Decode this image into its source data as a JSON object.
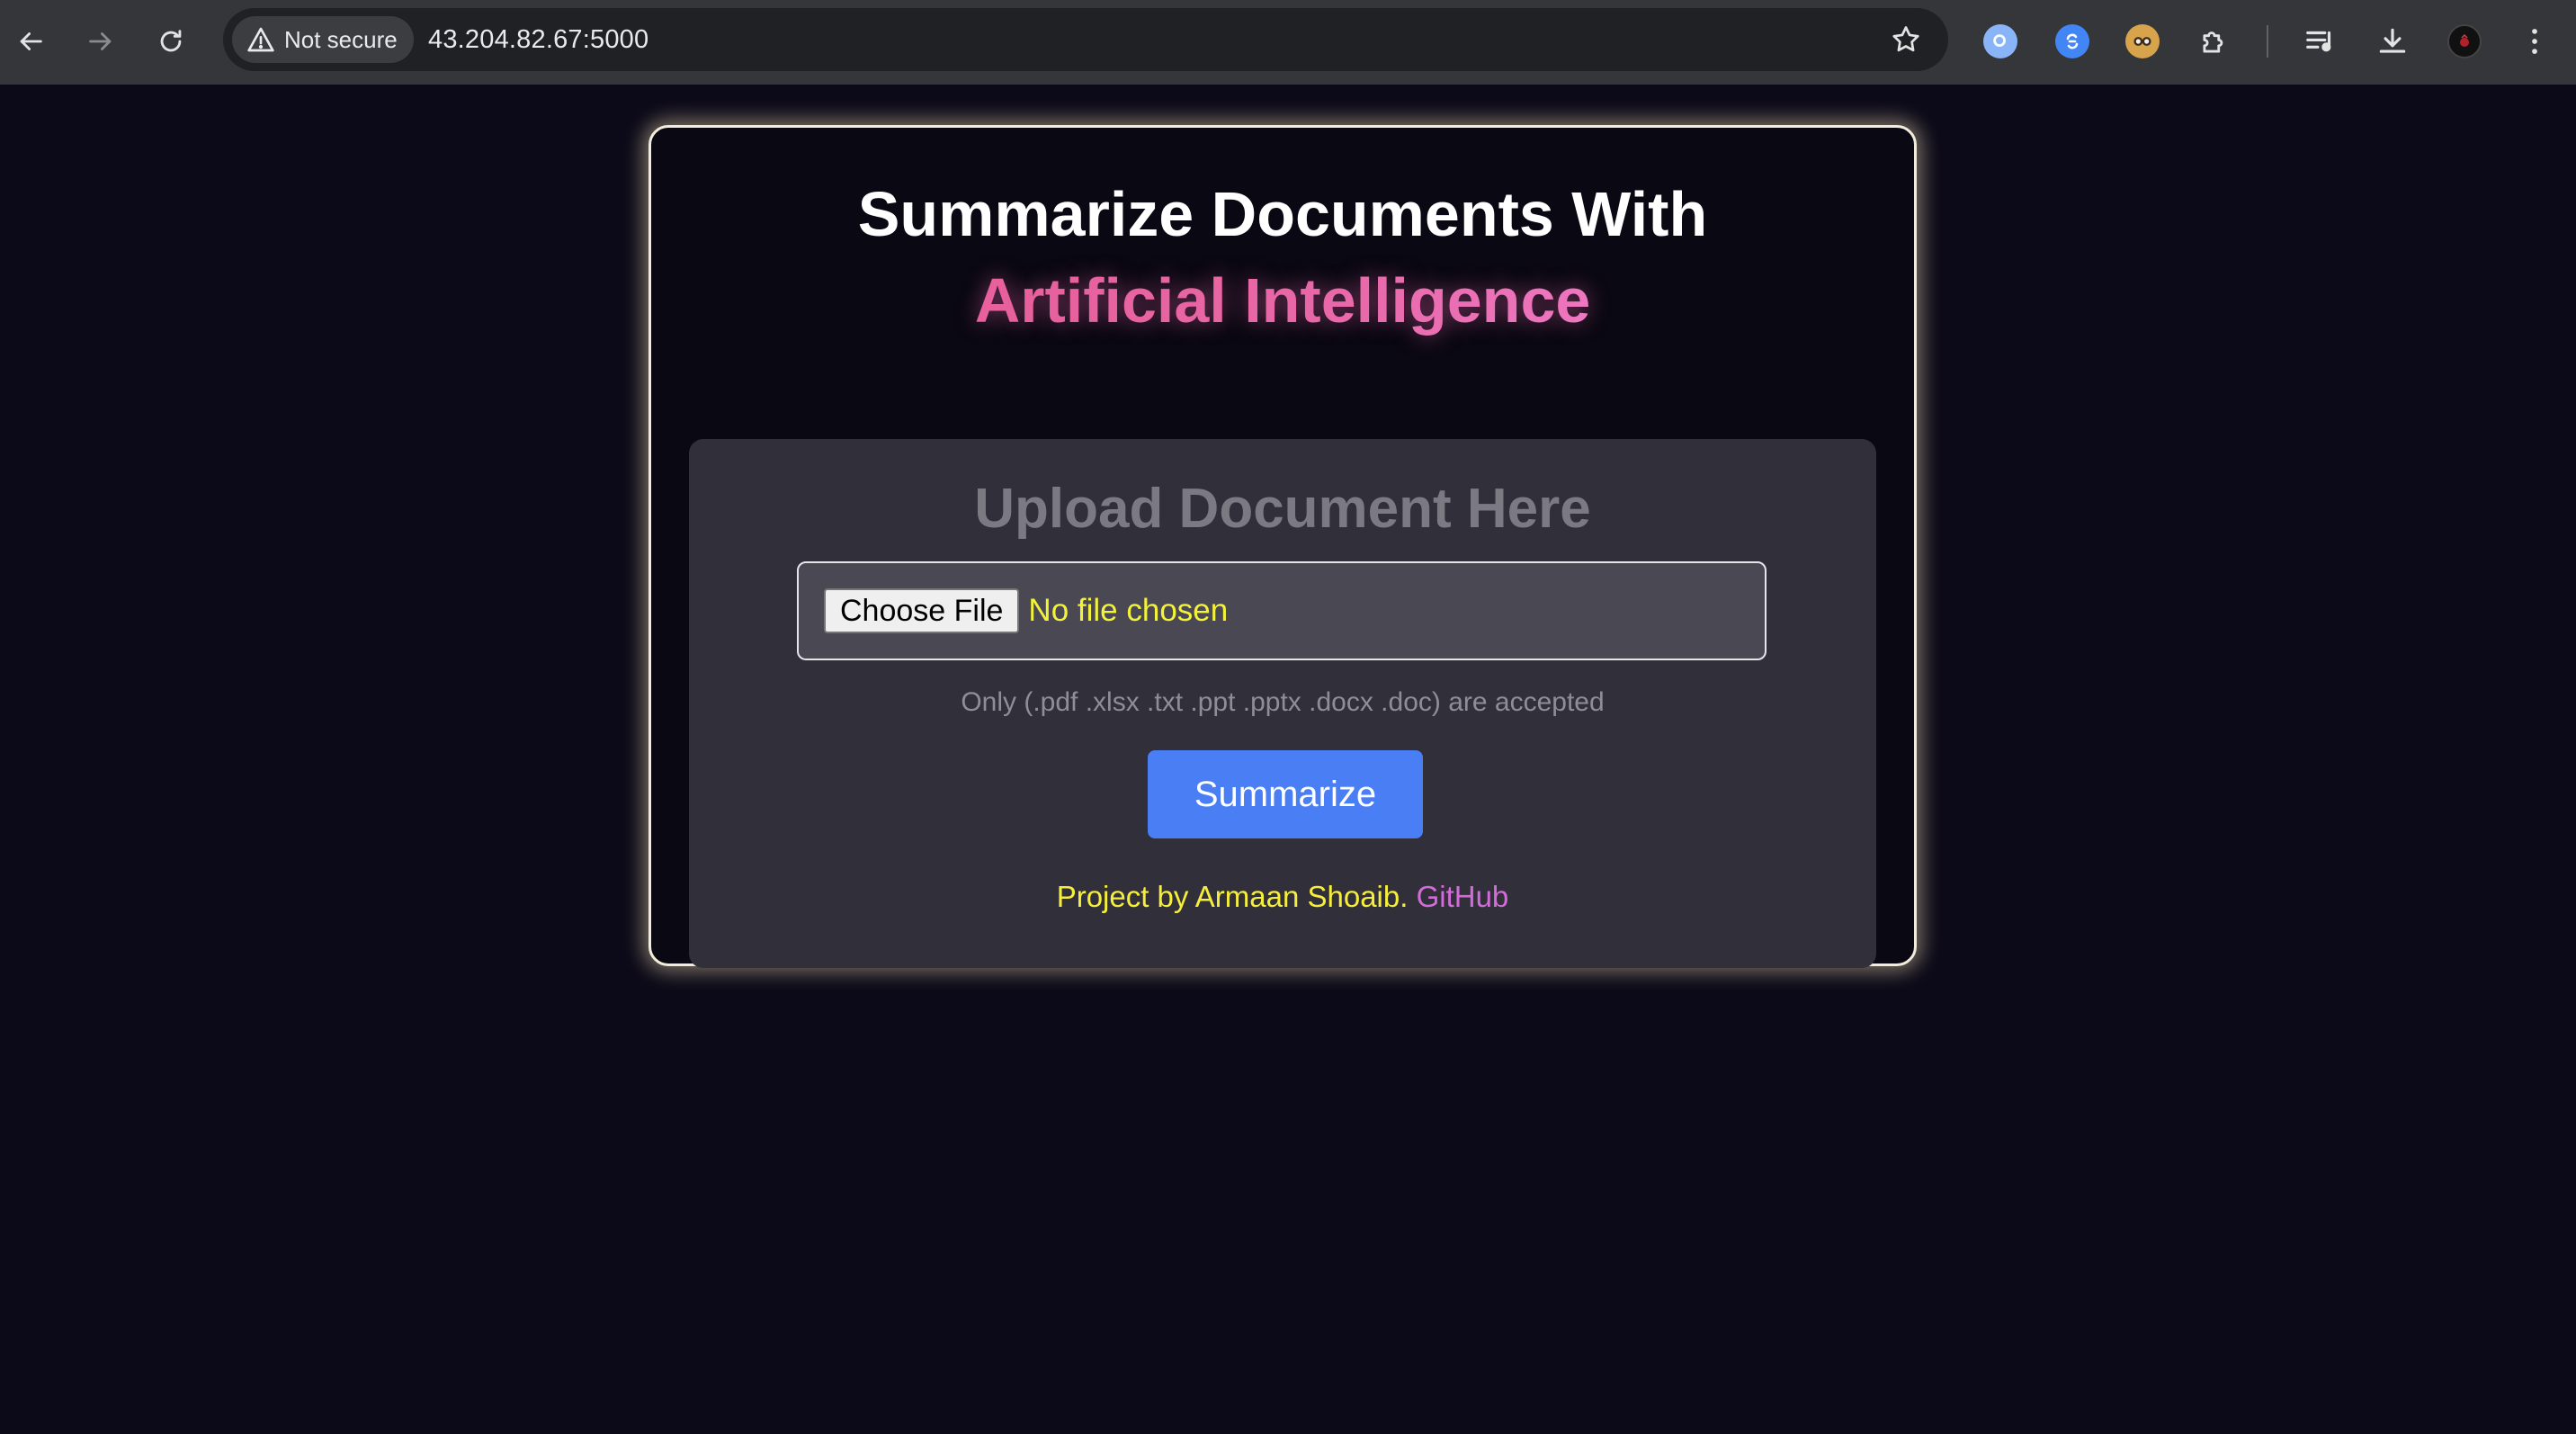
{
  "browser": {
    "security_label": "Not secure",
    "url": "43.204.82.67:5000"
  },
  "page": {
    "title": "Summarize Documents With",
    "subtitle": "Artificial Intelligence",
    "panel_heading": "Upload Document Here",
    "file_input": {
      "button_label": "Choose File",
      "status": "No file chosen"
    },
    "hint": "Only (.pdf .xlsx .txt .ppt .pptx .docx .doc) are accepted",
    "submit_label": "Summarize",
    "footer": {
      "credit": "Project by Armaan Shoaib.",
      "link": "GitHub"
    }
  },
  "colors": {
    "accent_pink": "#e8669c",
    "button_blue": "#4a7ef5",
    "credit_yellow": "#f5ef3c",
    "link_purple": "#d36bd9"
  }
}
